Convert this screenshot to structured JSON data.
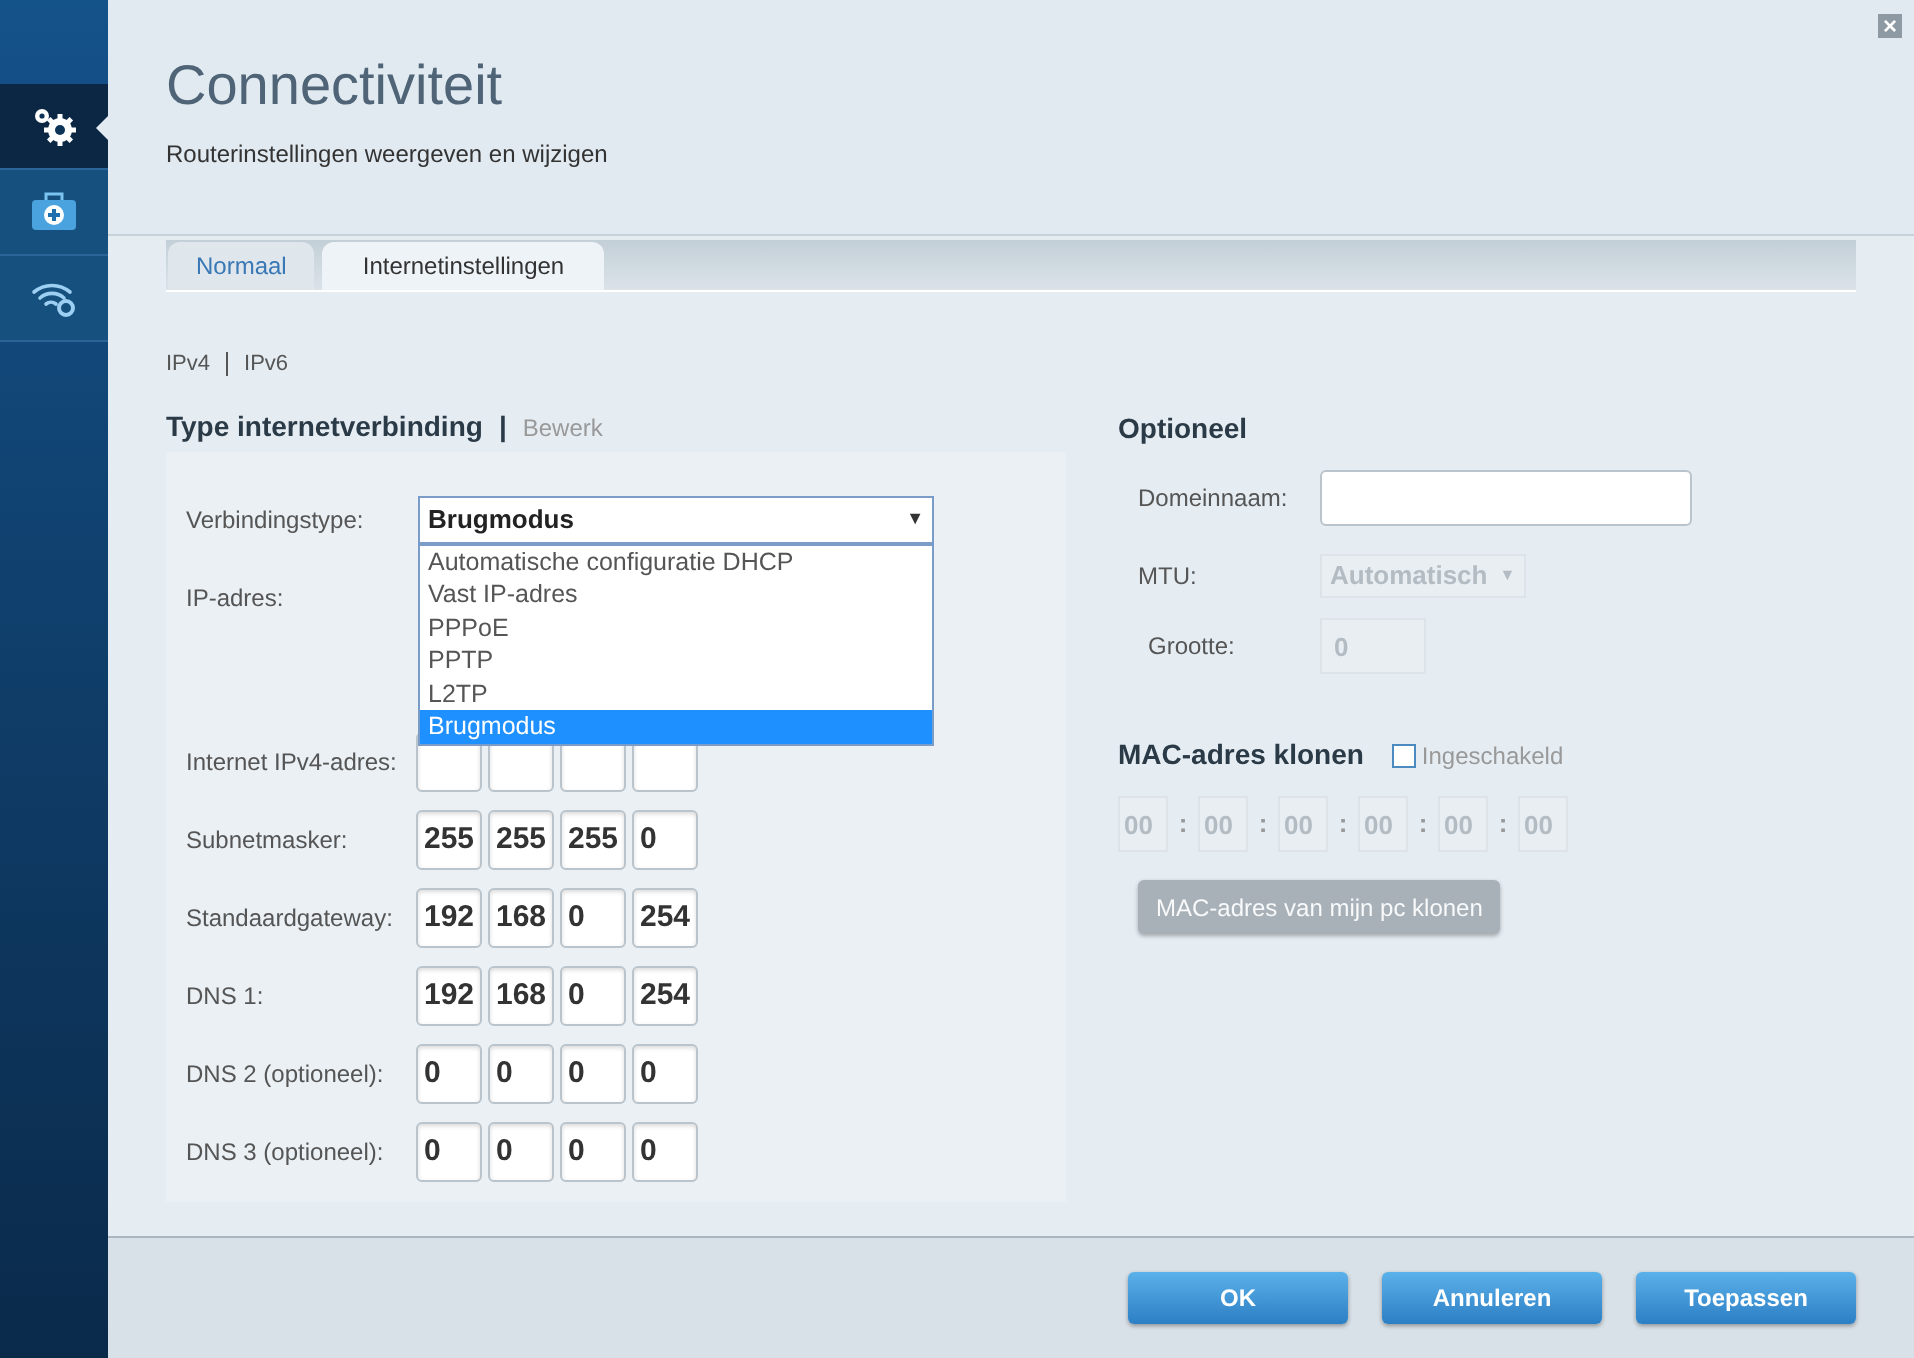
{
  "sidebar": {
    "items": [
      {
        "kind": "gears",
        "selected": true
      },
      {
        "kind": "medkit",
        "selected": false
      },
      {
        "kind": "wifi",
        "selected": false
      }
    ]
  },
  "header": {
    "title": "Connectiviteit",
    "subtitle": "Routerinstellingen weergeven en wijzigen"
  },
  "tabs": [
    {
      "label": "Normaal",
      "selected": false
    },
    {
      "label": "Internetinstellingen",
      "selected": true
    }
  ],
  "ip_links": [
    "IPv4",
    "IPv6"
  ],
  "connection": {
    "title": "Type internetverbinding",
    "separator": "|",
    "edit": "Bewerk",
    "type_label": "Verbindingstype:",
    "type_value": "Brugmodus",
    "caret": "▼",
    "options": [
      {
        "label": "Automatische configuratie DHCP",
        "selected": false
      },
      {
        "label": "Vast IP-adres",
        "selected": false
      },
      {
        "label": "PPPoE",
        "selected": false
      },
      {
        "label": "PPTP",
        "selected": false
      },
      {
        "label": "L2TP",
        "selected": false
      },
      {
        "label": "Brugmodus",
        "selected": true
      }
    ],
    "ip_label": "IP-adres:",
    "rows": [
      {
        "label": "Internet IPv4-adres:"
      },
      {
        "label": "Subnetmasker:",
        "octets": [
          "255",
          "255",
          "255",
          "0"
        ]
      },
      {
        "label": "Standaardgateway:",
        "octets": [
          "192",
          "168",
          "0",
          "254"
        ]
      },
      {
        "label": "DNS 1:",
        "octets": [
          "192",
          "168",
          "0",
          "254"
        ]
      },
      {
        "label": "DNS 2 (optioneel):",
        "octets": [
          "0",
          "0",
          "0",
          "0"
        ]
      },
      {
        "label": "DNS 3 (optioneel):",
        "octets": [
          "0",
          "0",
          "0",
          "0"
        ]
      }
    ]
  },
  "optional": {
    "title": "Optioneel",
    "domain_label": "Domeinnaam:",
    "mtu_label": "MTU:",
    "mtu_value": "Automatisch",
    "mtu_caret": "▼",
    "size_label": "Grootte:",
    "size_value": "0"
  },
  "mac": {
    "title": "MAC-adres klonen",
    "enabled_label": "Ingeschakeld",
    "checked": false,
    "octets": [
      "00",
      "00",
      "00",
      "00",
      "00",
      "00"
    ],
    "separator": ":",
    "clone_button": "MAC-adres van mijn pc klonen",
    "disabled": true
  },
  "buttons": [
    "OK",
    "Annuleren",
    "Toepassen"
  ],
  "close": "×"
}
